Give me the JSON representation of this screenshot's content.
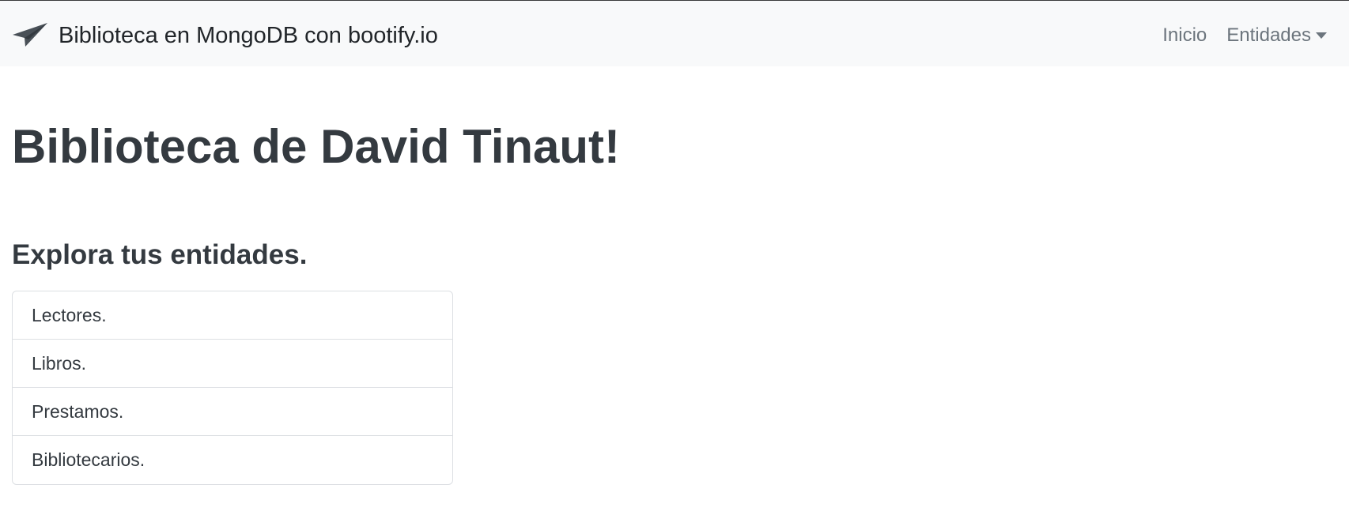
{
  "navbar": {
    "brand_icon": "paper-plane-icon",
    "brand_text": "Biblioteca en MongoDB con bootify.io",
    "links": {
      "home": "Inicio",
      "entities": "Entidades"
    },
    "caret_icon": "caret-down-icon"
  },
  "main": {
    "title": "Biblioteca de David Tinaut!",
    "subtitle": "Explora tus entidades.",
    "entities": [
      {
        "label": "Lectores."
      },
      {
        "label": "Libros."
      },
      {
        "label": "Prestamos."
      },
      {
        "label": "Bibliotecarios."
      }
    ]
  },
  "colors": {
    "navbar_bg": "#f8f9fa",
    "text_dark": "#343a40",
    "nav_link": "#6c757d",
    "border": "#dcdfe3"
  }
}
